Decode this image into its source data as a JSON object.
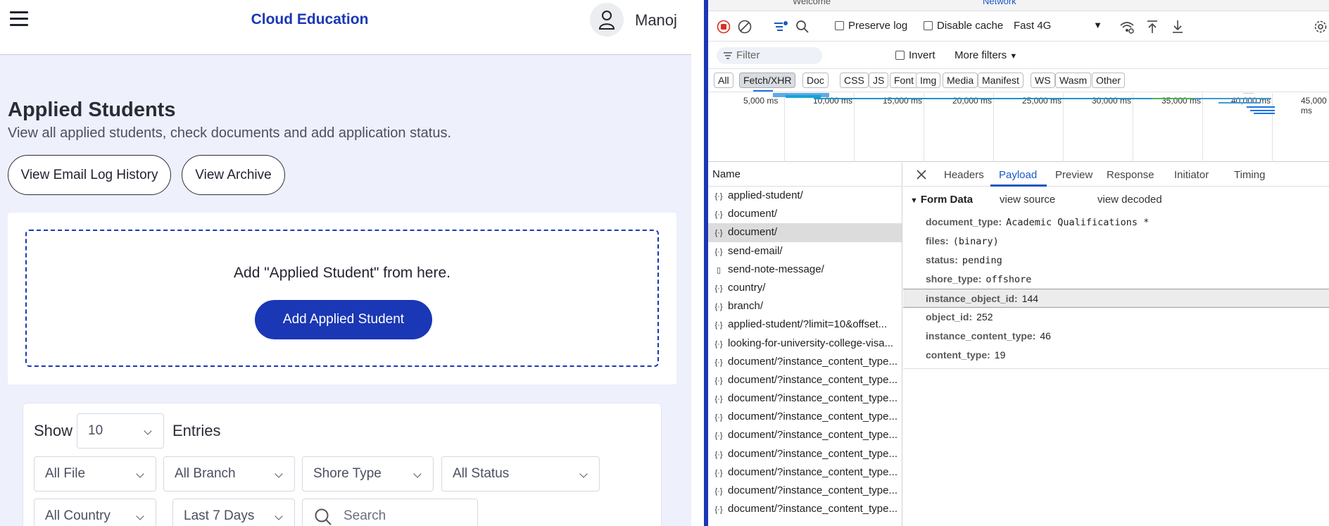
{
  "app": {
    "brand": "Cloud Education",
    "user_name": "Manoj",
    "page_title": "Applied Students",
    "page_subtitle": "View all applied students, check documents and add application status.",
    "email_log_button": "View Email Log History",
    "archive_button": "View Archive",
    "add_prompt": "Add \"Applied Student\" from here.",
    "add_button": "Add Applied Student",
    "show_label": "Show",
    "show_value": "10",
    "entries_label": "Entries",
    "filters": {
      "file": "All File",
      "branch": "All Branch",
      "shore": "Shore Type",
      "status": "All Status",
      "country": "All Country",
      "days": "Last 7 Days",
      "search_placeholder": "Search"
    }
  },
  "devtools": {
    "top_tabs": {
      "welcome": "Welcome",
      "network": "Network"
    },
    "toolbar": {
      "preserve_log": "Preserve log",
      "disable_cache": "Disable cache",
      "throttle": "Fast 4G"
    },
    "filter_placeholder": "Filter",
    "invert": "Invert",
    "more_filters": "More filters",
    "types": [
      "All",
      "Fetch/XHR",
      "Doc",
      "CSS",
      "JS",
      "Font",
      "Img",
      "Media",
      "Manifest",
      "WS",
      "Wasm",
      "Other"
    ],
    "active_type": "Fetch/XHR",
    "timeline_labels": [
      "5,000 ms",
      "10,000 ms",
      "15,000 ms",
      "20,000 ms",
      "25,000 ms",
      "30,000 ms",
      "35,000 ms",
      "40,000 ms",
      "45,000 ms"
    ],
    "name_header": "Name",
    "requests": [
      {
        "name": "applied-student/",
        "kind": "xhr"
      },
      {
        "name": "document/",
        "kind": "xhr"
      },
      {
        "name": "document/",
        "kind": "xhr",
        "selected": true
      },
      {
        "name": "send-email/",
        "kind": "xhr"
      },
      {
        "name": "send-note-message/",
        "kind": "doc"
      },
      {
        "name": "country/",
        "kind": "xhr"
      },
      {
        "name": "branch/",
        "kind": "xhr"
      },
      {
        "name": "applied-student/?limit=10&offset...",
        "kind": "xhr"
      },
      {
        "name": "looking-for-university-college-visa...",
        "kind": "xhr"
      },
      {
        "name": "document/?instance_content_type...",
        "kind": "xhr"
      },
      {
        "name": "document/?instance_content_type...",
        "kind": "xhr"
      },
      {
        "name": "document/?instance_content_type...",
        "kind": "xhr"
      },
      {
        "name": "document/?instance_content_type...",
        "kind": "xhr"
      },
      {
        "name": "document/?instance_content_type...",
        "kind": "xhr"
      },
      {
        "name": "document/?instance_content_type...",
        "kind": "xhr"
      },
      {
        "name": "document/?instance_content_type...",
        "kind": "xhr"
      },
      {
        "name": "document/?instance_content_type...",
        "kind": "xhr"
      },
      {
        "name": "document/?instance_content_type...",
        "kind": "xhr"
      }
    ],
    "detail_tabs": [
      "Headers",
      "Payload",
      "Preview",
      "Response",
      "Initiator",
      "Timing"
    ],
    "active_detail_tab": "Payload",
    "form_data_title": "Form Data",
    "view_source": "view source",
    "view_decoded": "view decoded",
    "form_data": [
      {
        "key": "document_type:",
        "value": "Academic Qualifications *",
        "mono": true
      },
      {
        "key": "files:",
        "value": "(binary)",
        "mono": true
      },
      {
        "key": "status:",
        "value": "pending",
        "mono": true
      },
      {
        "key": "shore_type:",
        "value": "offshore",
        "mono": true
      },
      {
        "key": "instance_object_id:",
        "value": "144",
        "mono": false,
        "highlight": true
      },
      {
        "key": "object_id:",
        "value": "252",
        "mono": false
      },
      {
        "key": "instance_content_type:",
        "value": "46",
        "mono": false
      },
      {
        "key": "content_type:",
        "value": "19",
        "mono": false
      }
    ]
  },
  "colors": {
    "brand": "#1a37b5",
    "app_bg": "#eef0fb",
    "devtools_accent": "#1a57c4"
  }
}
